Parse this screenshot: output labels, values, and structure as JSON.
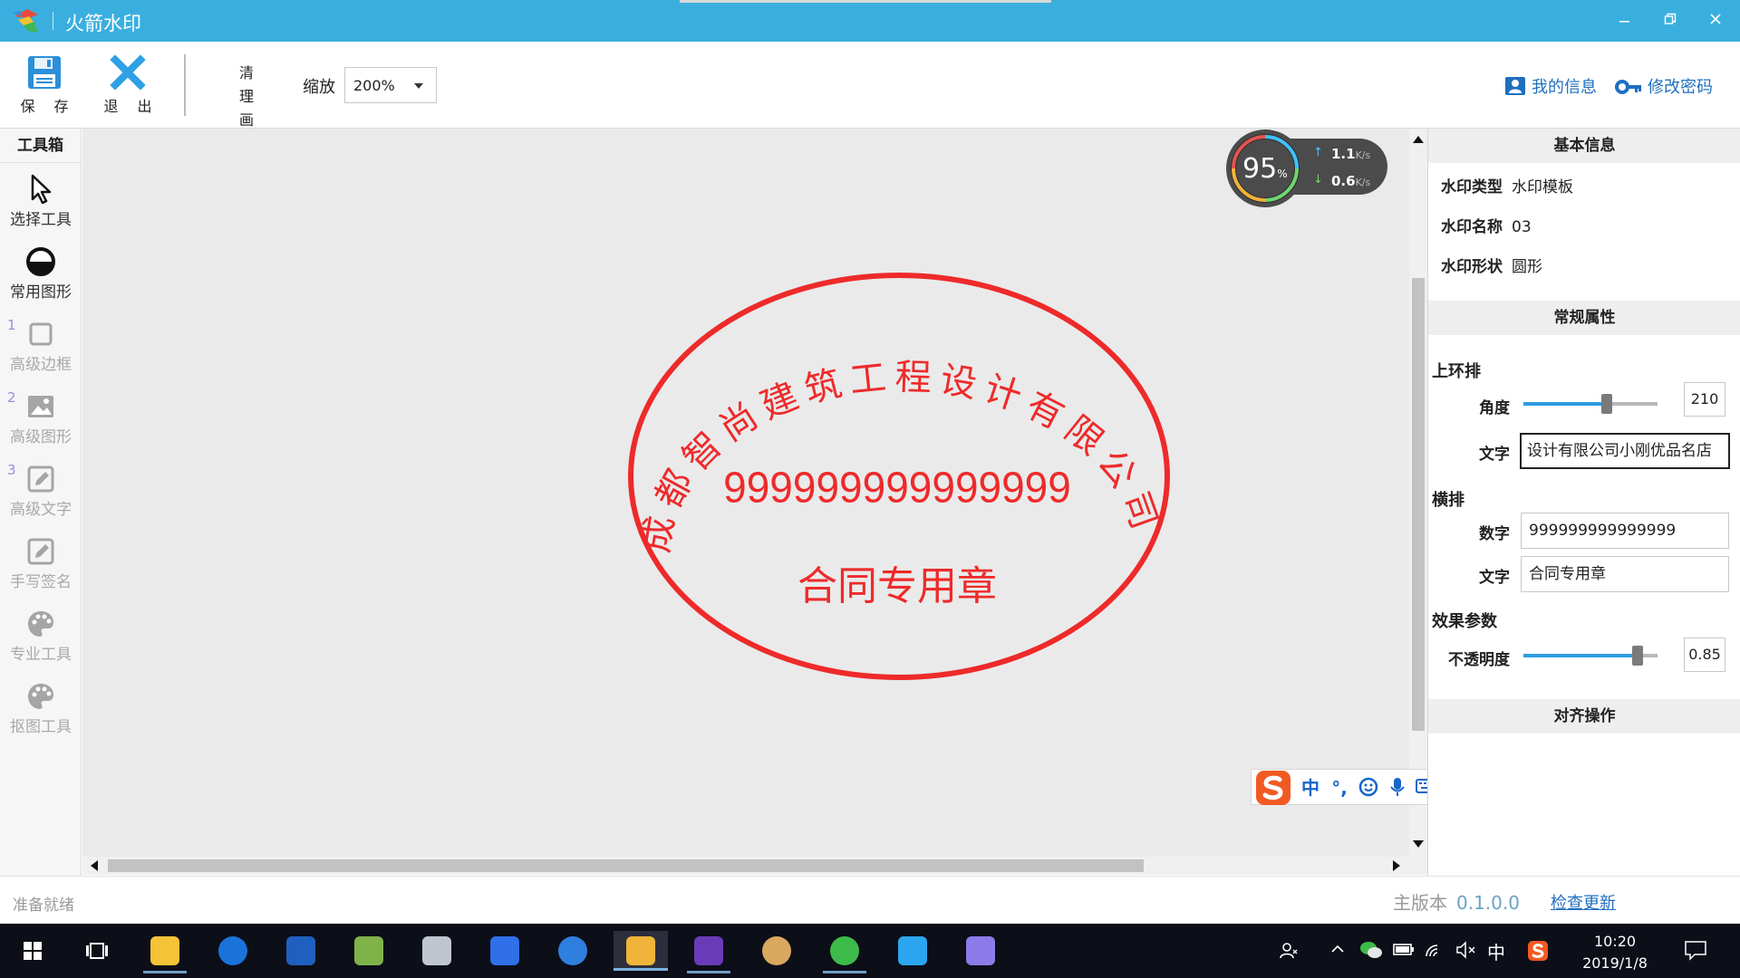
{
  "app": {
    "title": "火箭水印",
    "window_buttons": [
      "minimize",
      "restore",
      "close"
    ]
  },
  "toolbar": {
    "save_label": "保 存",
    "exit_label": "退 出",
    "clear_line1": "清 理",
    "clear_line2": "画 布",
    "zoom_label": "缩放",
    "zoom_value": "200%",
    "my_info": "我的信息",
    "change_password": "修改密码"
  },
  "toolbox": {
    "title": "工具箱",
    "tools": [
      {
        "label": "选择工具",
        "icon": "cursor-icon",
        "enabled": true
      },
      {
        "label": "常用图形",
        "icon": "shape-circle-icon",
        "enabled": true
      },
      {
        "label": "高级边框",
        "icon": "square-frame-icon",
        "enabled": false,
        "num": "1"
      },
      {
        "label": "高级图形",
        "icon": "image-icon",
        "enabled": false,
        "num": "2"
      },
      {
        "label": "高级文字",
        "icon": "edit-text-icon",
        "enabled": false,
        "num": "3"
      },
      {
        "label": "手写签名",
        "icon": "signature-icon",
        "enabled": false
      },
      {
        "label": "专业工具",
        "icon": "palette-icon",
        "enabled": false
      },
      {
        "label": "抠图工具",
        "icon": "palette-icon",
        "enabled": false
      }
    ]
  },
  "stamp": {
    "arc_text": "成都智尚建筑工程设计有限公司小刚优品名店",
    "number": "999999999999999",
    "center_text": "合同专用章",
    "color": "#ee2a2a"
  },
  "net_widget": {
    "percent": "95",
    "percent_unit": "%",
    "up_speed": "1.1",
    "down_speed": "0.6",
    "speed_unit": "K/s"
  },
  "ime": {
    "mode": "中",
    "punct": "°,",
    "icons": [
      "emoji-icon",
      "mic-icon",
      "keyboard-icon",
      "user-icon",
      "shirt-icon",
      "grid-icon"
    ]
  },
  "panel": {
    "basic_title": "基本信息",
    "type_label": "水印类型",
    "type_value": "水印模板",
    "name_label": "水印名称",
    "name_value": "03",
    "shape_label": "水印形状",
    "shape_value": "圆形",
    "general_title": "常规属性",
    "upper_ring": "上环排",
    "angle_label": "角度",
    "angle_value": "210",
    "angle_fraction": 0.62,
    "text_label": "文字",
    "arc_text_value": "设计有限公司小刚优品名店",
    "horizontal": "横排",
    "number_label": "数字",
    "number_value": "999999999999999",
    "text2_label": "文字",
    "center_text_value": "合同专用章",
    "effect_title": "效果参数",
    "opacity_label": "不透明度",
    "opacity_value": "0.85",
    "align_title": "对齐操作"
  },
  "status": {
    "ready": "准备就绪",
    "version_label": "主版本",
    "version": "0.1.0.0",
    "check_update": "检查更新"
  },
  "taskbar": {
    "time": "10:20",
    "date": "2019/1/8",
    "ime_char": "中"
  }
}
